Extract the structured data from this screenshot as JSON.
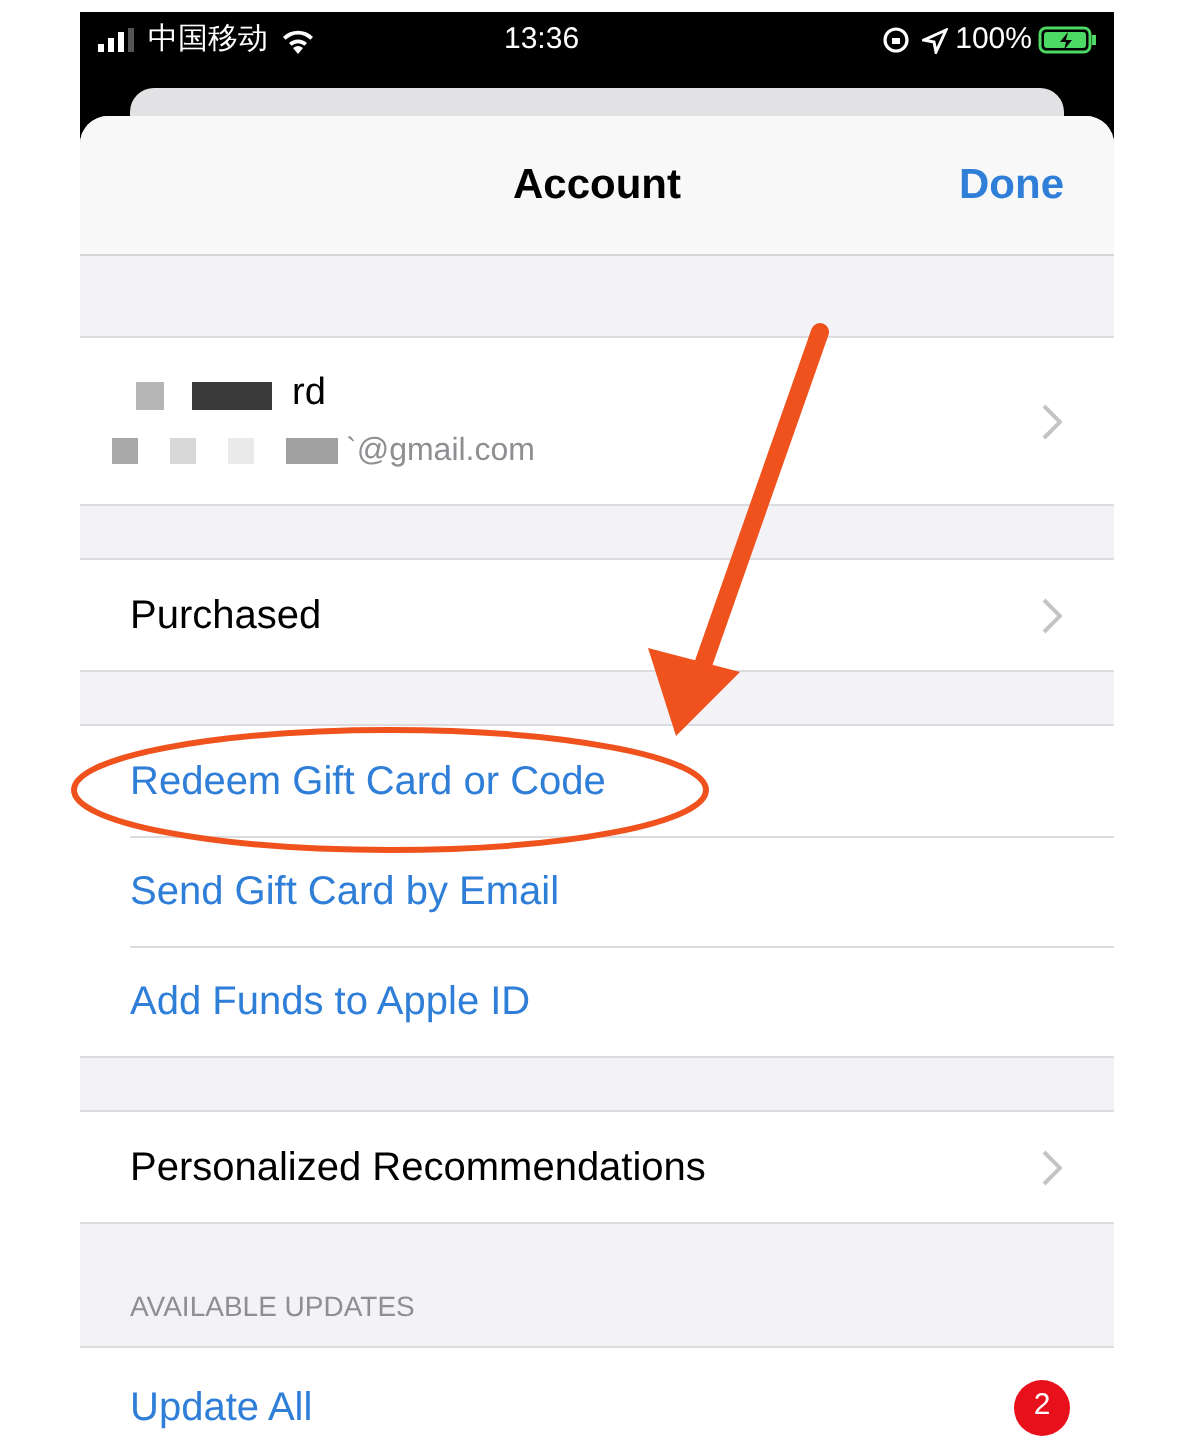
{
  "status_bar": {
    "carrier": "中国移动",
    "time": "13:36",
    "battery": "100%"
  },
  "header": {
    "title": "Account",
    "done": "Done"
  },
  "account": {
    "name": "rd",
    "email": "`@gmail.com"
  },
  "groups": [
    [
      {
        "kind": "nav",
        "label": "Purchased"
      }
    ],
    [
      {
        "kind": "action",
        "label": "Redeem Gift Card or Code"
      },
      {
        "kind": "action",
        "label": "Send Gift Card by Email"
      },
      {
        "kind": "action",
        "label": "Add Funds to Apple ID"
      }
    ],
    [
      {
        "kind": "nav",
        "label": "Personalized Recommendations"
      }
    ]
  ],
  "updates": {
    "section": "AVAILABLE UPDATES",
    "label": "Update All",
    "badge": "2"
  }
}
